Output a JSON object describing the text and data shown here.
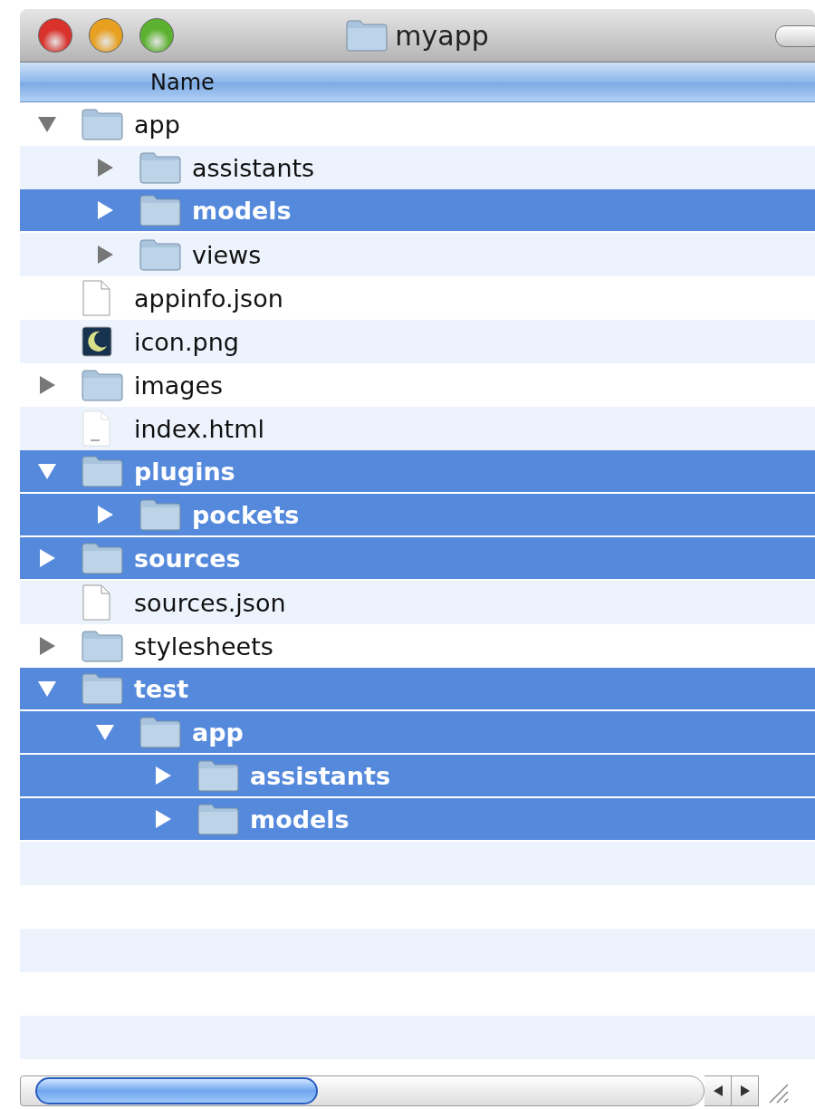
{
  "window": {
    "title": "myapp"
  },
  "header": {
    "column_1": "Name"
  },
  "items": [
    {
      "name": "app",
      "kind": "folder",
      "expanded": true,
      "selected": false,
      "children": [
        {
          "name": "assistants",
          "kind": "folder",
          "expanded": false,
          "selected": false
        },
        {
          "name": "models",
          "kind": "folder",
          "expanded": false,
          "selected": true
        },
        {
          "name": "views",
          "kind": "folder",
          "expanded": false,
          "selected": false
        }
      ]
    },
    {
      "name": "appinfo.json",
      "kind": "file",
      "selected": false
    },
    {
      "name": "icon.png",
      "kind": "image",
      "selected": false
    },
    {
      "name": "images",
      "kind": "folder",
      "expanded": false,
      "selected": false
    },
    {
      "name": "index.html",
      "kind": "web",
      "selected": false
    },
    {
      "name": "plugins",
      "kind": "folder",
      "expanded": true,
      "selected": true,
      "children": [
        {
          "name": "pockets",
          "kind": "folder",
          "expanded": false,
          "selected": true
        }
      ]
    },
    {
      "name": "sources",
      "kind": "folder",
      "expanded": false,
      "selected": true
    },
    {
      "name": "sources.json",
      "kind": "file",
      "selected": false
    },
    {
      "name": "stylesheets",
      "kind": "folder",
      "expanded": false,
      "selected": false
    },
    {
      "name": "test",
      "kind": "folder",
      "expanded": true,
      "selected": true,
      "children": [
        {
          "name": "app",
          "kind": "folder",
          "expanded": true,
          "selected": true,
          "children": [
            {
              "name": "assistants",
              "kind": "folder",
              "expanded": false,
              "selected": true
            },
            {
              "name": "models",
              "kind": "folder",
              "expanded": false,
              "selected": true
            }
          ]
        }
      ]
    }
  ]
}
